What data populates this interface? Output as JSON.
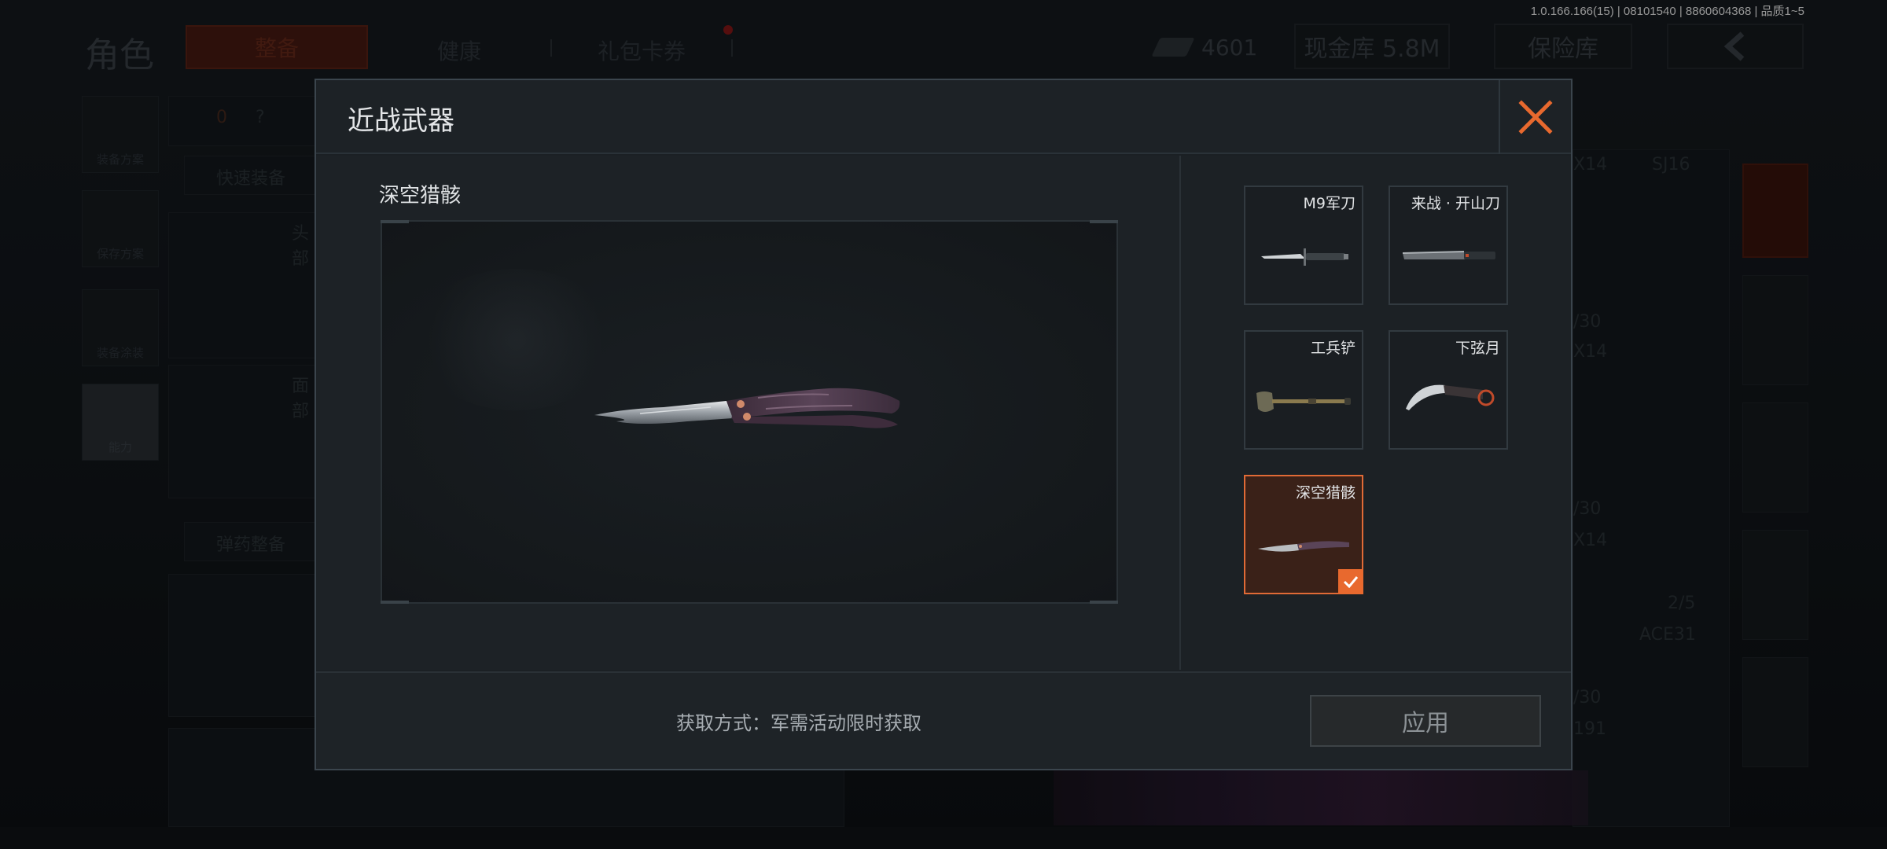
{
  "build_info": "1.0.166.166(15) | 08101540 | 8860604368 | 品质1~5",
  "background": {
    "role_title": "角色",
    "tabs": [
      {
        "label": "整备"
      },
      {
        "label": "健康"
      },
      {
        "label": "礼包卡券"
      }
    ],
    "currency_value": "4601",
    "cash_vault": "现金库 5.8M",
    "insurance_vault": "保险库",
    "left_nav": [
      {
        "label": "装备方案"
      },
      {
        "label": "保存方案"
      },
      {
        "label": "装备涂装"
      },
      {
        "label": "能力"
      }
    ],
    "quick_equip": "快速装备",
    "ammo_equip": "弹药整备",
    "armor_count": "0",
    "help": "?",
    "head_label": "头部",
    "face_label": "面部",
    "weapon_labels": [
      "SJ16",
      "ACE31"
    ],
    "side_counts": [
      "/30",
      "/30",
      "2/5",
      "/30"
    ],
    "side_codes": [
      "X14",
      "X14",
      "X14",
      "191"
    ]
  },
  "modal": {
    "title": "近战武器",
    "preview_name": "深空猎骸",
    "weapons": [
      {
        "name": "M9军刀",
        "selected": false,
        "icon": "bayonet-icon"
      },
      {
        "name": "来战 · 开山刀",
        "selected": false,
        "icon": "machete-icon"
      },
      {
        "name": "工兵铲",
        "selected": false,
        "icon": "shovel-icon"
      },
      {
        "name": "下弦月",
        "selected": false,
        "icon": "karambit-icon"
      },
      {
        "name": "深空猎骸",
        "selected": true,
        "icon": "butterfly-knife-icon"
      }
    ],
    "acquire_text": "获取方式：军需活动限时获取",
    "apply_label": "应用"
  },
  "colors": {
    "accent_orange": "#e8692e",
    "modal_bg": "#1b2024"
  }
}
